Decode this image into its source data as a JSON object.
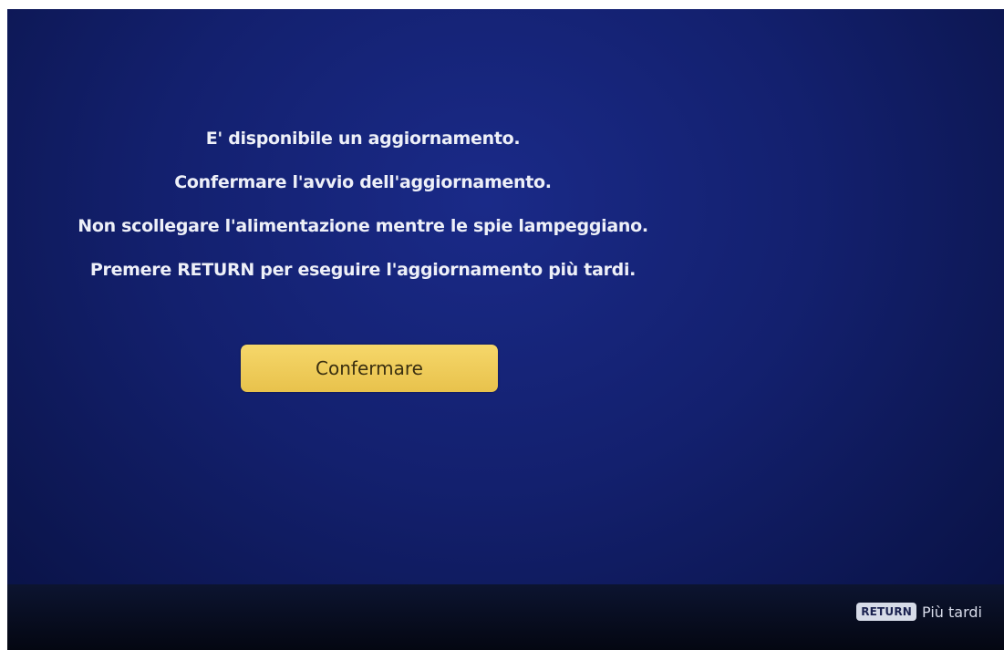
{
  "dialog": {
    "lines": [
      "E' disponibile un aggiornamento.",
      "Confermare l'avvio dell'aggiornamento.",
      "Non scollegare l'alimentazione mentre le spie lampeggiano.",
      "Premere RETURN per eseguire l'aggiornamento più tardi."
    ],
    "confirm_label": "Confermare"
  },
  "footer": {
    "key_label": "RETURN",
    "hint_label": "Più tardi"
  },
  "colors": {
    "background": "#13206e",
    "button": "#f0cd5a",
    "text": "#eef0f8"
  }
}
